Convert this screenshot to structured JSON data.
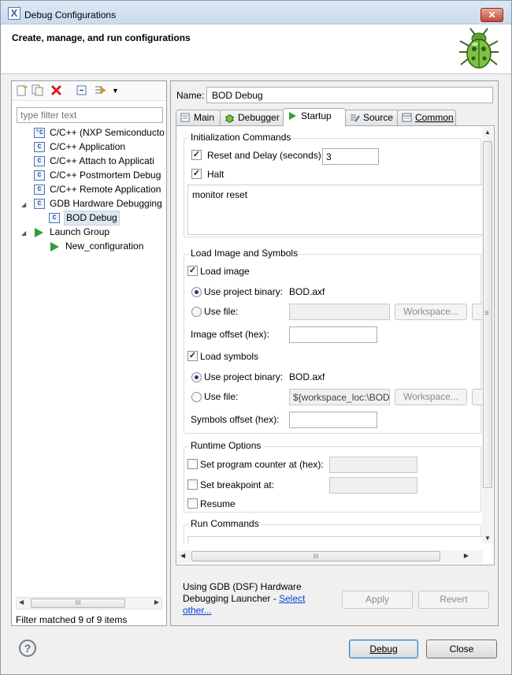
{
  "window": {
    "title": "Debug Configurations",
    "close_glyph": "✕",
    "app_glyph": "X"
  },
  "header": {
    "title": "Create, manage, and run configurations"
  },
  "left": {
    "filter_placeholder": "type filter text",
    "tree": [
      {
        "label": "C/C++ (NXP Semiconducto",
        "icon": "c-nxp-icon",
        "icon_text": "°C"
      },
      {
        "label": "C/C++ Application",
        "icon": "c-app-icon",
        "icon_text": "C"
      },
      {
        "label": "C/C++ Attach to Applicati",
        "icon": "c-attach-icon",
        "icon_text": "C"
      },
      {
        "label": "C/C++ Postmortem Debug",
        "icon": "c-postmortem-icon",
        "icon_text": "C"
      },
      {
        "label": "C/C++ Remote Application",
        "icon": "c-remote-icon",
        "icon_text": "C"
      },
      {
        "label": "GDB Hardware Debugging",
        "icon": "c-gdb-icon",
        "icon_text": "C"
      },
      {
        "label": "BOD Debug",
        "icon": "c-config-icon",
        "icon_text": "C"
      },
      {
        "label": "Launch Group",
        "icon": "launch-group-icon"
      },
      {
        "label": "New_configuration",
        "icon": "launch-config-icon"
      }
    ],
    "filter_message": "Filter matched 9 of 9 items",
    "scroll_grip": "III"
  },
  "right": {
    "name_label": "Name:",
    "name_value": "BOD Debug",
    "tabs": [
      {
        "label": "Main"
      },
      {
        "label": "Debugger"
      },
      {
        "label": "Startup"
      },
      {
        "label": "Source"
      },
      {
        "label": "Common"
      }
    ],
    "init": {
      "title": "Initialization Commands",
      "reset_label": "Reset and Delay (seconds):",
      "reset_value": "3",
      "halt_label": "Halt",
      "commands": "monitor reset"
    },
    "load": {
      "title": "Load Image and Symbols",
      "load_image_label": "Load image",
      "use_project_binary_label": "Use project binary:",
      "project_binary": "BOD.axf",
      "use_file_label": "Use file:",
      "workspace_label": "Workspace...",
      "image_offset_label": "Image offset (hex):",
      "load_symbols_label": "Load symbols",
      "symbols_project_binary": "BOD.axf",
      "symbols_file_value": "${workspace_loc:\\BOD\\",
      "symbols_offset_label": "Symbols offset (hex):"
    },
    "runtime": {
      "title": "Runtime Options",
      "pc_label": "Set program counter at (hex):",
      "bp_label": "Set breakpoint at:",
      "resume_label": "Resume"
    },
    "run": {
      "title": "Run Commands"
    },
    "launcher": {
      "text": "Using GDB (DSF) Hardware Debugging Launcher - ",
      "link": "Select other..."
    },
    "apply_label": "Apply",
    "revert_label": "Revert",
    "scroll_grip": "III",
    "vscroll_grip": "≡"
  },
  "footer": {
    "help_glyph": "?",
    "debug_label": "Debug",
    "close_label": "Close"
  },
  "colors": {
    "accent": "#3c7fb1",
    "play_green": "#2fa135",
    "link": "#0645d2"
  }
}
